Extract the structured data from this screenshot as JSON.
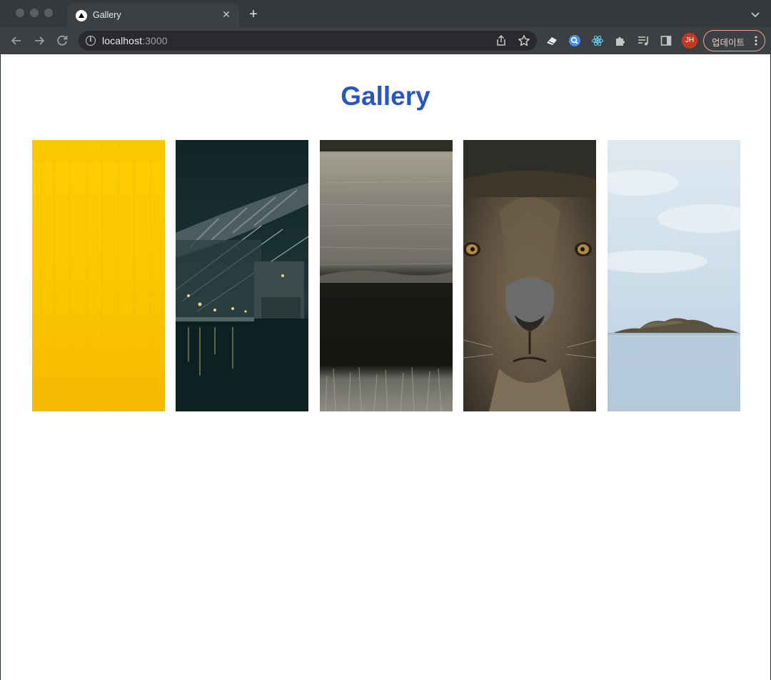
{
  "browser": {
    "tab_title": "Gallery",
    "url_host": "localhost",
    "url_port": ":3000",
    "avatar_initials": "JH",
    "update_label": "업데이트"
  },
  "page": {
    "title": "Gallery",
    "title_color": "#2756c6",
    "images": [
      {
        "name": "yellow-texture-photo"
      },
      {
        "name": "bridge-at-night-photo"
      },
      {
        "name": "frosty-field-photo"
      },
      {
        "name": "lion-face-photo"
      },
      {
        "name": "island-seascape-photo"
      }
    ]
  },
  "icons": [
    "back-arrow-icon",
    "forward-arrow-icon",
    "reload-icon",
    "info-icon",
    "share-icon",
    "star-icon",
    "extension-icons",
    "puzzle-icon",
    "reading-list-icon",
    "side-panel-icon",
    "more-vert-icon"
  ]
}
